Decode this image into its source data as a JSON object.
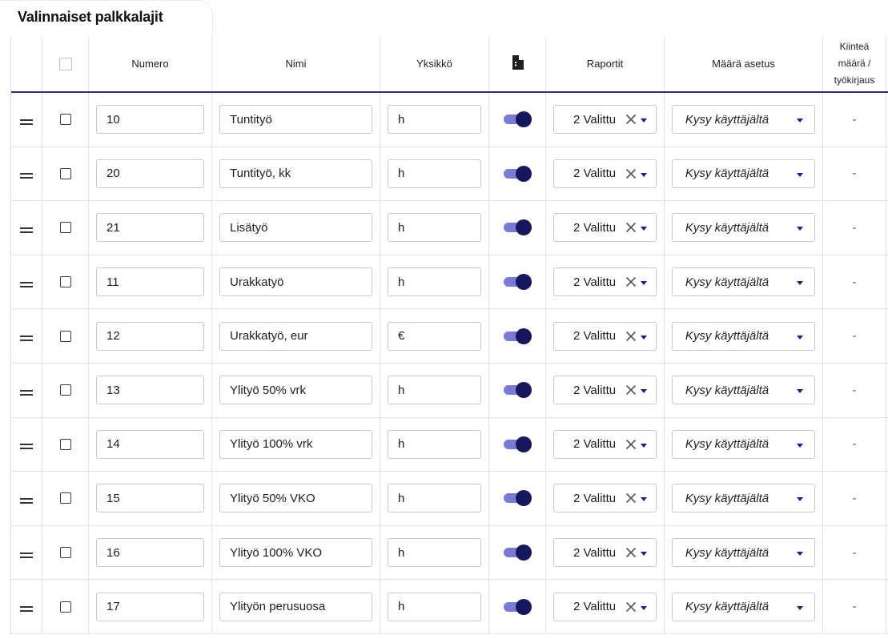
{
  "section": {
    "title": "Valinnaiset palkkalajit"
  },
  "table": {
    "columns": {
      "numero": "Numero",
      "nimi": "Nimi",
      "yksikko": "Yksikkö",
      "raportit": "Raportit",
      "maara_asetus": "Määrä asetus",
      "kiintea_1": "Kiinteä",
      "kiintea_2": "määrä /",
      "kiintea_3": "työkirjaus"
    },
    "rows": [
      {
        "numero": "10",
        "nimi": "Tuntityö",
        "yksikko": "h",
        "enabled": true,
        "raportit": "2 Valittu",
        "maara": "Kysy käyttäjältä",
        "kiintea": "-"
      },
      {
        "numero": "20",
        "nimi": "Tuntityö, kk",
        "yksikko": "h",
        "enabled": true,
        "raportit": "2 Valittu",
        "maara": "Kysy käyttäjältä",
        "kiintea": "-"
      },
      {
        "numero": "21",
        "nimi": "Lisätyö",
        "yksikko": "h",
        "enabled": true,
        "raportit": "2 Valittu",
        "maara": "Kysy käyttäjältä",
        "kiintea": "-"
      },
      {
        "numero": "11",
        "nimi": "Urakkatyö",
        "yksikko": "h",
        "enabled": true,
        "raportit": "2 Valittu",
        "maara": "Kysy käyttäjältä",
        "kiintea": "-"
      },
      {
        "numero": "12",
        "nimi": "Urakkatyö, eur",
        "yksikko": "€",
        "enabled": true,
        "raportit": "2 Valittu",
        "maara": "Kysy käyttäjältä",
        "kiintea": "-"
      },
      {
        "numero": "13",
        "nimi": "Ylityö 50% vrk",
        "yksikko": "h",
        "enabled": true,
        "raportit": "2 Valittu",
        "maara": "Kysy käyttäjältä",
        "kiintea": "-"
      },
      {
        "numero": "14",
        "nimi": "Ylityö 100% vrk",
        "yksikko": "h",
        "enabled": true,
        "raportit": "2 Valittu",
        "maara": "Kysy käyttäjältä",
        "kiintea": "-"
      },
      {
        "numero": "15",
        "nimi": "Ylityö 50% VKO",
        "yksikko": "h",
        "enabled": true,
        "raportit": "2 Valittu",
        "maara": "Kysy käyttäjältä",
        "kiintea": "-"
      },
      {
        "numero": "16",
        "nimi": "Ylityö 100% VKO",
        "yksikko": "h",
        "enabled": true,
        "raportit": "2 Valittu",
        "maara": "Kysy käyttäjältä",
        "kiintea": "-"
      },
      {
        "numero": "17",
        "nimi": "Ylityön perusuosa",
        "yksikko": "h",
        "enabled": true,
        "raportit": "2 Valittu",
        "maara": "Kysy käyttäjältä",
        "kiintea": "-"
      }
    ]
  },
  "icons": {
    "drag": "drag-handle-icon",
    "document": "document-icon",
    "clear": "close-icon",
    "dropdown": "caret-down-icon"
  },
  "colors": {
    "accent": "#17175e",
    "toggle_track": "#7a7ad6",
    "header_rule": "#2f2f7a",
    "caret": "#1c1c8c"
  }
}
